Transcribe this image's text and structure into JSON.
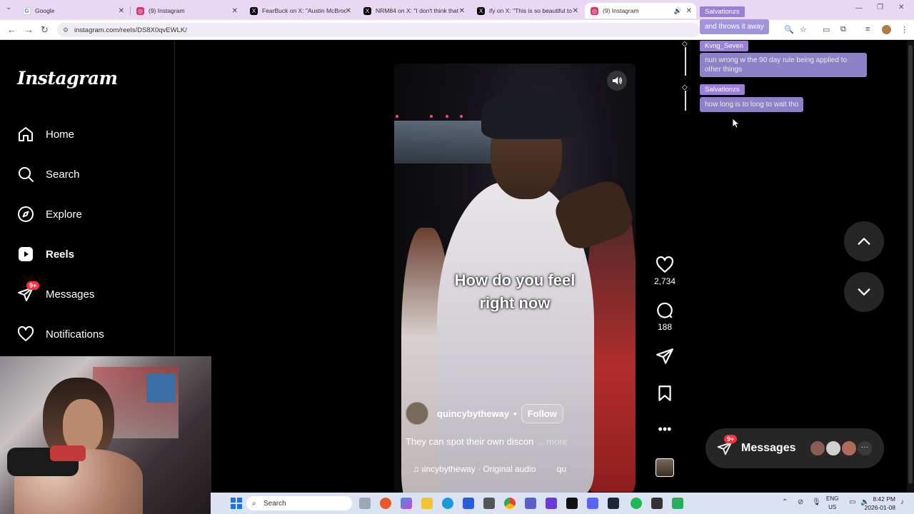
{
  "browser": {
    "tabs": [
      {
        "title": "Google",
        "icon": "google-icon",
        "color": "#4285f4"
      },
      {
        "title": "(9) Instagram",
        "icon": "instagram-icon",
        "color": "#e1306c"
      },
      {
        "title": "FearBuck on X: \"Austin McBroom",
        "icon": "x-icon",
        "color": "#000000"
      },
      {
        "title": "NRM84 on X: \"I don't think that",
        "icon": "x-icon",
        "color": "#000000"
      },
      {
        "title": "ify on X: \"This is so beautiful to",
        "icon": "x-icon",
        "color": "#000000"
      },
      {
        "title": "(9) Instagram",
        "icon": "instagram-icon",
        "color": "#e1306c",
        "active": true
      }
    ],
    "url": "instagram.com/reels/DS8X0qvEWLK/"
  },
  "sidebar": {
    "logo": "Instagram",
    "items": [
      {
        "label": "Home",
        "icon": "home-icon"
      },
      {
        "label": "Search",
        "icon": "search-icon"
      },
      {
        "label": "Explore",
        "icon": "compass-icon"
      },
      {
        "label": "Reels",
        "icon": "reels-icon",
        "active": true
      },
      {
        "label": "Messages",
        "icon": "messenger-icon",
        "badge": "9+"
      },
      {
        "label": "Notifications",
        "icon": "heart-icon"
      }
    ]
  },
  "reel": {
    "overlay_text_line1": "How do you feel",
    "overlay_text_line2": "right now",
    "author": "quincybytheway",
    "separator": "•",
    "follow_label": "Follow",
    "caption": "They can spot their own discon",
    "more_label": "... more",
    "audio": "ıincybytheway · Original audio",
    "audio_tail": "qu"
  },
  "actions": {
    "likes": "2,734",
    "comments": "188"
  },
  "messages_dock": {
    "label": "Messages",
    "badge": "9+"
  },
  "chat": [
    {
      "user": "Salvationzs",
      "message": "and throws it away"
    },
    {
      "user": "Kvng_Seven",
      "message": "nun wrong w the 90 day rule being applied to other things"
    },
    {
      "user": "Salvationzs",
      "message": "how long is to long to wait tho"
    }
  ],
  "taskbar": {
    "search_placeholder": "Search",
    "lang_line1": "ENG",
    "lang_line2": "US",
    "time": "8:42 PM",
    "date": "2026-01-08"
  }
}
